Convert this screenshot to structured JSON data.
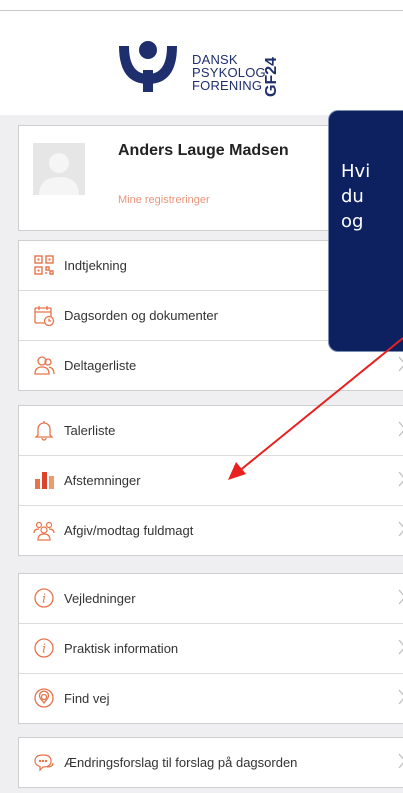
{
  "logo": {
    "line1": "DANSK",
    "line2": "PSYKOLOG",
    "line3": "FORENING",
    "event": "GF24"
  },
  "profile": {
    "name": "Anders Lauge Madsen",
    "link": "Mine registreringer"
  },
  "menu_groups": [
    {
      "items": [
        {
          "label": "Indtjekning",
          "icon": "qr-code-icon"
        },
        {
          "label": "Dagsorden og dokumenter",
          "icon": "calendar-clock-icon"
        },
        {
          "label": "Deltagerliste",
          "icon": "people-icon"
        }
      ]
    },
    {
      "items": [
        {
          "label": "Talerliste",
          "icon": "bell-icon"
        },
        {
          "label": "Afstemninger",
          "icon": "bar-chart-icon"
        },
        {
          "label": "Afgiv/modtag fuldmagt",
          "icon": "group-icon"
        }
      ]
    },
    {
      "items": [
        {
          "label": "Vejledninger",
          "icon": "info-icon"
        },
        {
          "label": "Praktisk information",
          "icon": "info-icon"
        },
        {
          "label": "Find vej",
          "icon": "location-pin-icon"
        }
      ]
    },
    {
      "items": [
        {
          "label": "Ændringsforslag til forslag på dagsorden",
          "icon": "speech-bubbles-icon"
        }
      ]
    }
  ],
  "tooltip": {
    "line1": "Hvi",
    "line2": "du",
    "line3": "og"
  },
  "colors": {
    "brand_navy": "#1f2f6e",
    "accent_orange": "#e8734a",
    "tooltip_bg": "#0d2160",
    "annotation_arrow": "#e8201f"
  }
}
